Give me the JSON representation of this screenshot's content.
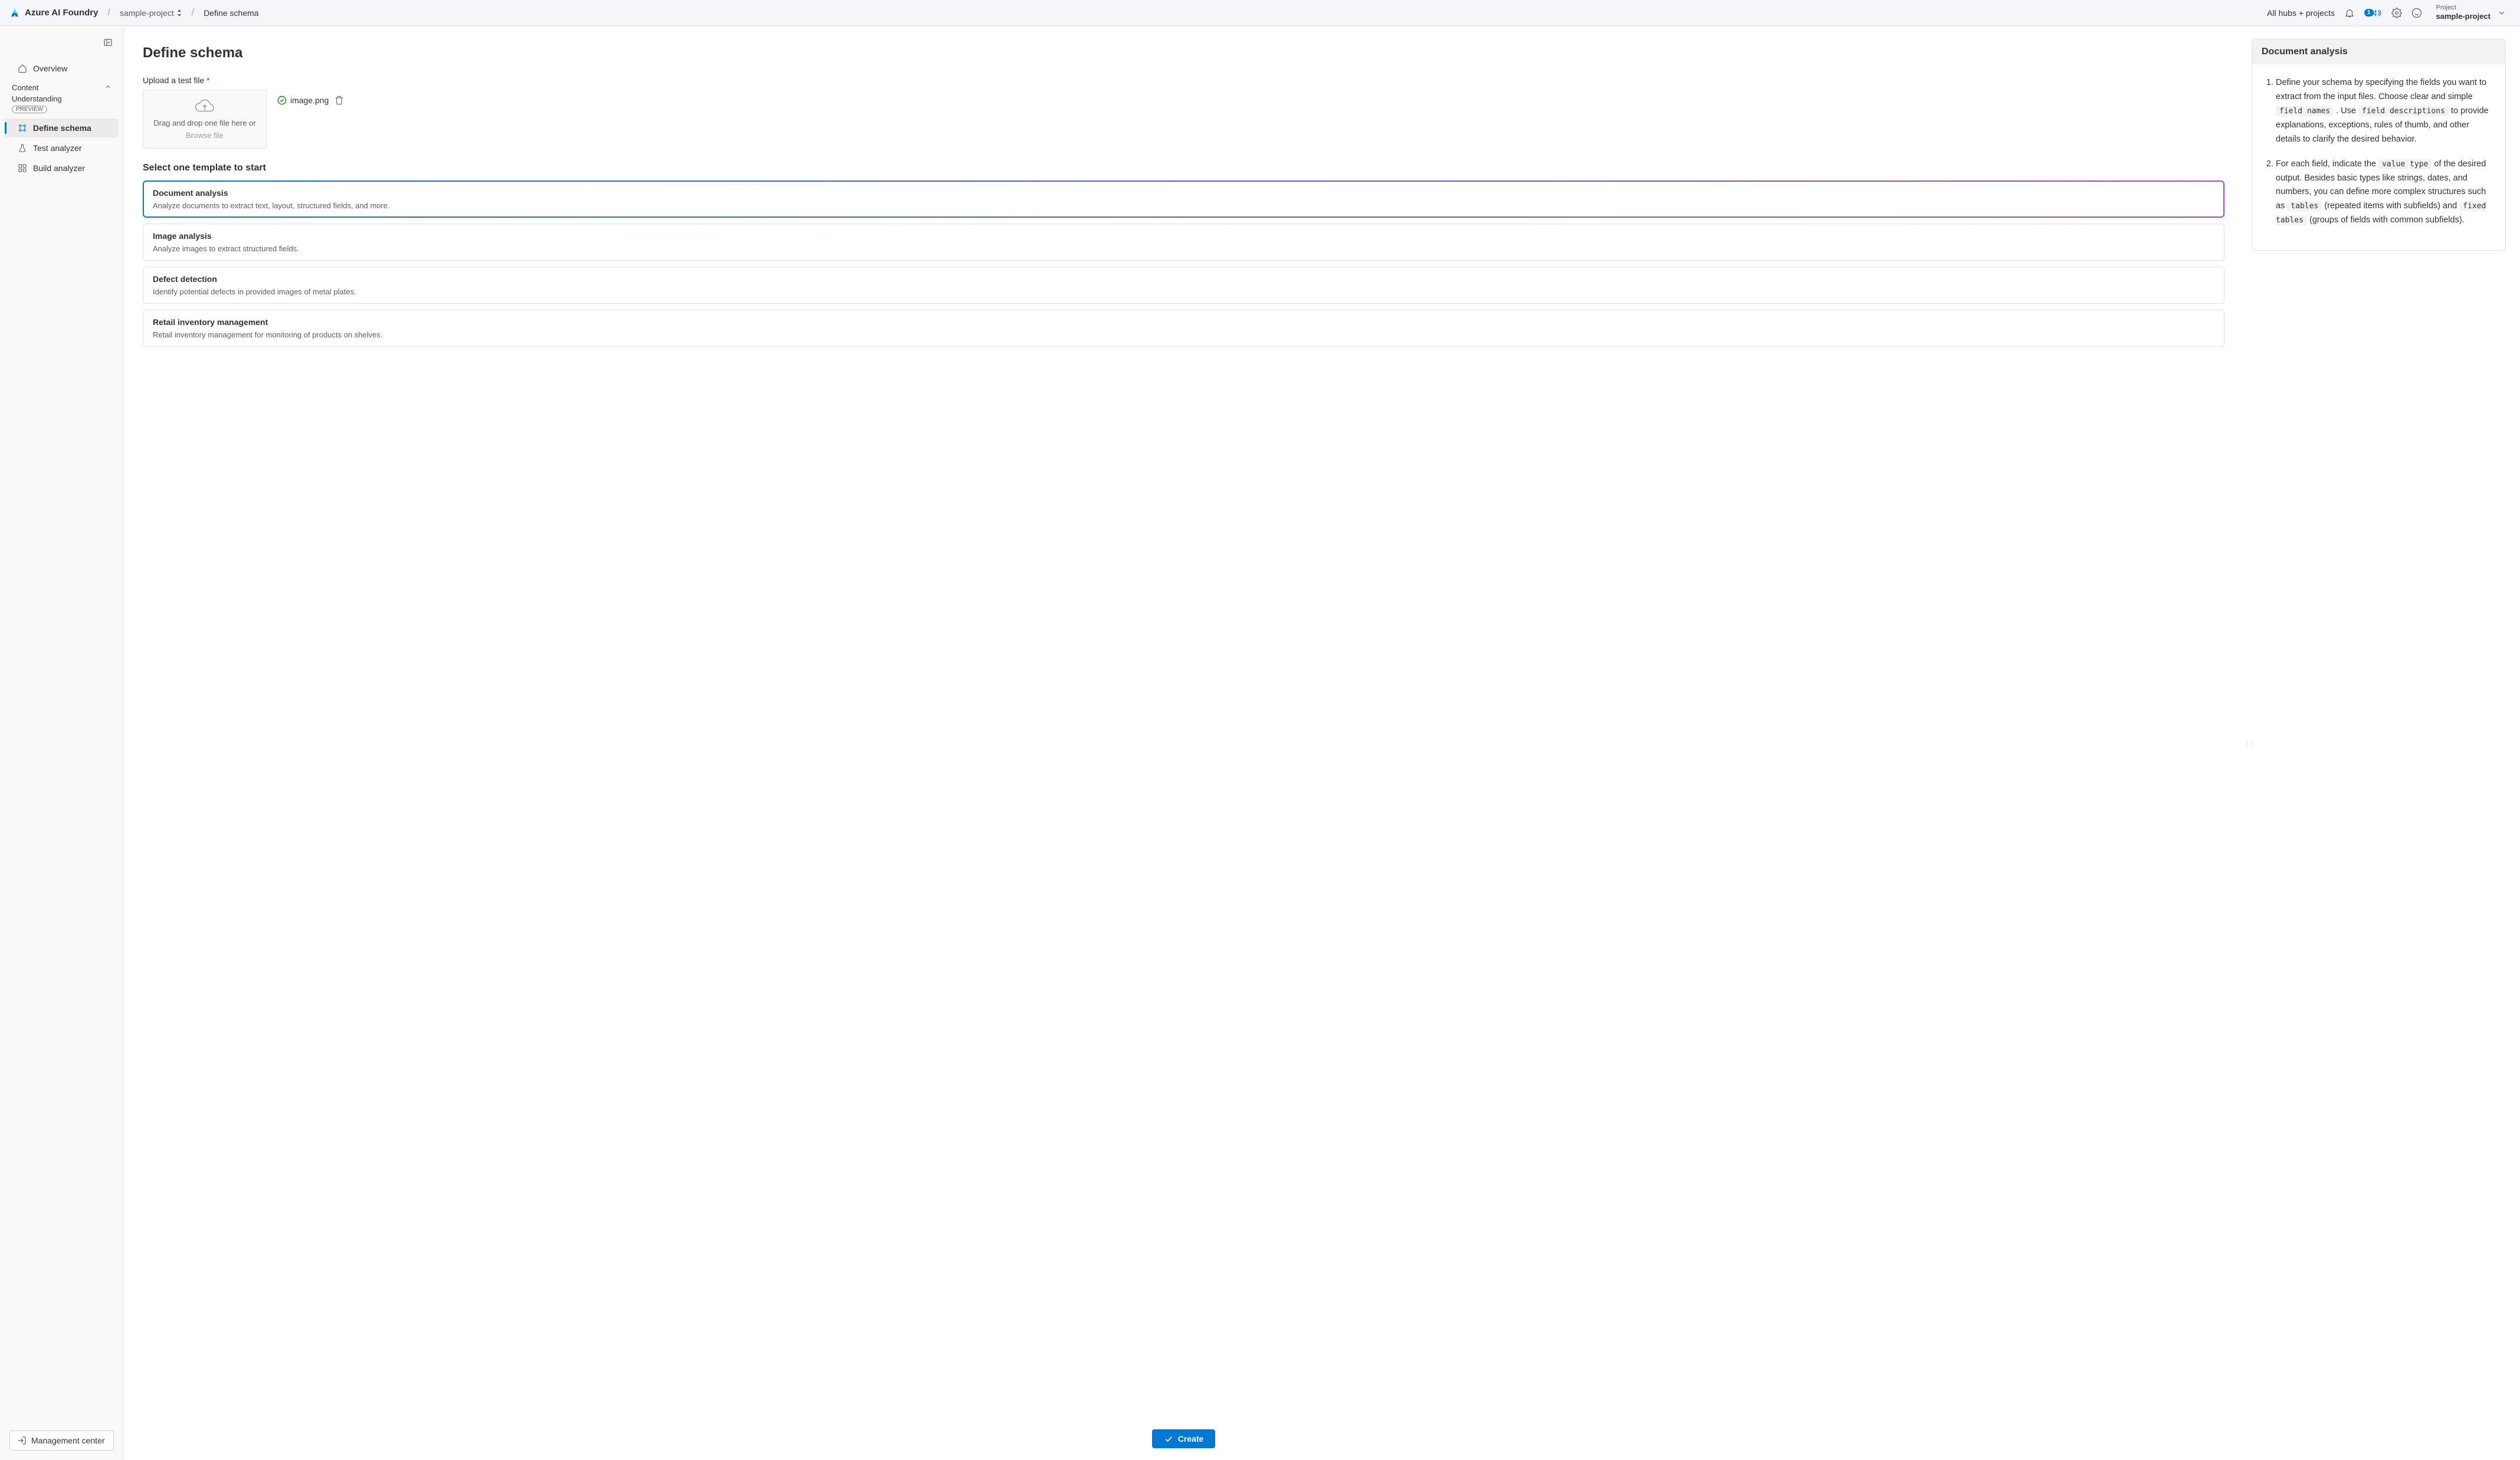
{
  "header": {
    "app_name": "Azure AI Foundry",
    "breadcrumb_project": "sample-project",
    "breadcrumb_current": "Define schema",
    "hubs_link": "All hubs + projects",
    "announcement_badge": "1",
    "project_label": "Project",
    "project_value": "sample-project"
  },
  "sidebar": {
    "overview": "Overview",
    "group_label_1": "Content",
    "group_label_2": "Understanding",
    "preview_badge": "PREVIEW",
    "define_schema": "Define schema",
    "test_analyzer": "Test analyzer",
    "build_analyzer": "Build analyzer",
    "management_center": "Management center"
  },
  "main": {
    "page_title": "Define schema",
    "upload_label": "Upload a test file",
    "dropzone_text": "Drag and drop one file here or",
    "browse_text": "Browse file",
    "uploaded_filename": "image.png",
    "templates_heading": "Select one template to start",
    "templates": [
      {
        "title": "Document analysis",
        "desc": "Analyze documents to extract text, layout, structured fields, and more."
      },
      {
        "title": "Image analysis",
        "desc": "Analyze images to extract structured fields."
      },
      {
        "title": "Defect detection",
        "desc": "Identify potential defects in provided images of metal plates."
      },
      {
        "title": "Retail inventory management",
        "desc": "Retail inventory management for monitoring of products on shelves."
      }
    ],
    "create_label": "Create"
  },
  "info": {
    "title": "Document analysis",
    "item1_a": "Define your schema by specifying the fields you want to extract from the input files. Choose clear and simple ",
    "item1_code1": "field names",
    "item1_b": " . Use ",
    "item1_code2": "field descriptions",
    "item1_c": " to provide explanations, exceptions, rules of thumb, and other details to clarify the desired behavior.",
    "item2_a": "For each field, indicate the ",
    "item2_code1": "value type",
    "item2_b": " of the desired output. Besides basic types like strings, dates, and numbers, you can define more complex structures such as ",
    "item2_code2": "tables",
    "item2_c": " (repeated items with subfields) and ",
    "item2_code3": "fixed tables",
    "item2_d": " (groups of fields with common subfields)."
  }
}
